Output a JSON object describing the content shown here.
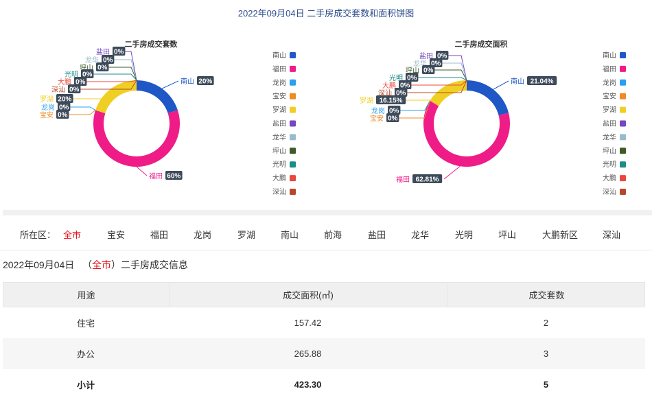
{
  "page_title": "2022年09月04日 二手房成交套数和面积饼图",
  "chart_data": [
    {
      "type": "pie",
      "title": "二手房成交套数",
      "unit": "%",
      "slices": [
        {
          "name": "南山",
          "value": 20,
          "label": "20%",
          "color": "#1f57c6"
        },
        {
          "name": "福田",
          "value": 60,
          "label": "60%",
          "color": "#ef1c88"
        },
        {
          "name": "龙岗",
          "value": 0,
          "label": "0%",
          "color": "#2aa0ef"
        },
        {
          "name": "宝安",
          "value": 0,
          "label": "0%",
          "color": "#f08a24"
        },
        {
          "name": "罗湖",
          "value": 20,
          "label": "20%",
          "color": "#f0cf25"
        },
        {
          "name": "盐田",
          "value": 0,
          "label": "0%",
          "color": "#7447c3"
        },
        {
          "name": "龙华",
          "value": 0,
          "label": "0%",
          "color": "#99bccb"
        },
        {
          "name": "坪山",
          "value": 0,
          "label": "0%",
          "color": "#3e5b26"
        },
        {
          "name": "光明",
          "value": 0,
          "label": "0%",
          "color": "#1c8c8c"
        },
        {
          "name": "大鹏",
          "value": 0,
          "label": "0%",
          "color": "#e8483e"
        },
        {
          "name": "深汕",
          "value": 0,
          "label": "0%",
          "color": "#b5482a"
        }
      ]
    },
    {
      "type": "pie",
      "title": "二手房成交面积",
      "unit": "%",
      "slices": [
        {
          "name": "南山",
          "value": 21.04,
          "label": "21.04%",
          "color": "#1f57c6"
        },
        {
          "name": "福田",
          "value": 62.81,
          "label": "62.81%",
          "color": "#ef1c88"
        },
        {
          "name": "龙岗",
          "value": 0,
          "label": "0%",
          "color": "#2aa0ef"
        },
        {
          "name": "宝安",
          "value": 0,
          "label": "0%",
          "color": "#f08a24"
        },
        {
          "name": "罗湖",
          "value": 16.15,
          "label": "16.15%",
          "color": "#f0cf25"
        },
        {
          "name": "盐田",
          "value": 0,
          "label": "0%",
          "color": "#7447c3"
        },
        {
          "name": "龙华",
          "value": 0,
          "label": "0%",
          "color": "#99bccb"
        },
        {
          "name": "坪山",
          "value": 0,
          "label": "0%",
          "color": "#3e5b26"
        },
        {
          "name": "光明",
          "value": 0,
          "label": "0%",
          "color": "#1c8c8c"
        },
        {
          "name": "大鹏",
          "value": 0,
          "label": "0%",
          "color": "#e8483e"
        },
        {
          "name": "深汕",
          "value": 0,
          "label": "0%",
          "color": "#b5482a"
        }
      ]
    }
  ],
  "district_filter": {
    "label": "所在区：",
    "options": [
      "全市",
      "宝安",
      "福田",
      "龙岗",
      "罗湖",
      "南山",
      "前海",
      "盐田",
      "龙华",
      "光明",
      "坪山",
      "大鹏新区",
      "深汕"
    ],
    "selected": "全市"
  },
  "info": {
    "date": "2022年09月04日",
    "open_paren": "（",
    "district": "全市",
    "close_paren": "）",
    "suffix": "二手房成交信息"
  },
  "table": {
    "headers": [
      "用途",
      "成交面积(㎡)",
      "成交套数"
    ],
    "rows": [
      [
        "住宅",
        "157.42",
        "2"
      ],
      [
        "办公",
        "265.88",
        "3"
      ],
      [
        "小计",
        "423.30",
        "5"
      ]
    ]
  }
}
